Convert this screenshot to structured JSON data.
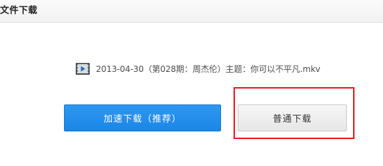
{
  "dialog": {
    "title": "文件下载"
  },
  "file": {
    "name": "2013-04-30（第028期：周杰伦）主题：你可以不平凡.mkv",
    "icon": "video-file-icon"
  },
  "buttons": {
    "fast_download_label": "加速下载（推荐）",
    "normal_download_label": "普通下载"
  },
  "colors": {
    "primary_button": "#1a86e6",
    "highlight_border": "#e8131b"
  }
}
